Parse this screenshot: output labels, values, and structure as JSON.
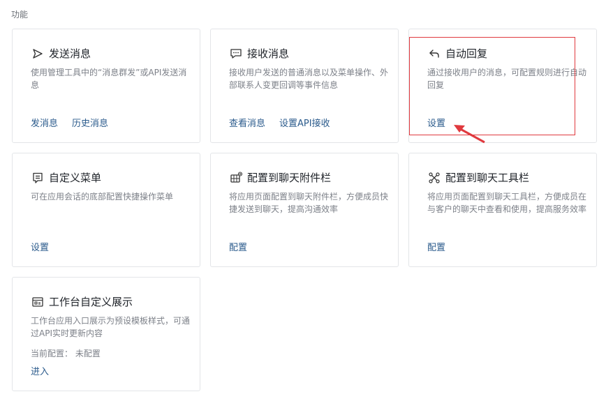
{
  "section_title": "功能",
  "cards": [
    {
      "title": "发送消息",
      "icon": "send-icon",
      "desc": "使用管理工具中的“消息群发”或API发送消息",
      "actions": [
        "发消息",
        "历史消息"
      ]
    },
    {
      "title": "接收消息",
      "icon": "chat-bubble-icon",
      "desc": "接收用户发送的普通消息以及菜单操作、外部联系人变更回调等事件信息",
      "actions": [
        "查看消息",
        "设置API接收"
      ]
    },
    {
      "title": "自动回复",
      "icon": "reply-icon",
      "desc": "通过接收用户的消息，可配置规则进行自动回复",
      "actions": [
        "设置"
      ]
    },
    {
      "title": "自定义菜单",
      "icon": "menu-icon",
      "desc": "可在应用会话的底部配置快捷操作菜单",
      "actions": [
        "设置"
      ]
    },
    {
      "title": "配置到聊天附件栏",
      "icon": "attachment-grid-icon",
      "desc": "将应用页面配置到聊天附件栏，方便成员快捷发送到聊天，提高沟通效率",
      "actions": [
        "配置"
      ]
    },
    {
      "title": "配置到聊天工具栏",
      "icon": "toolbar-icon",
      "desc": "将应用页面配置到聊天工具栏，方便成员在与客户的聊天中查看和使用，提高服务效率",
      "actions": [
        "配置"
      ]
    },
    {
      "title": "工作台自定义展示",
      "icon": "workbench-icon",
      "desc": "工作台应用入口展示为预设模板样式，可通过API实时更新内容",
      "status": "当前配置： 未配置",
      "actions": [
        "进入"
      ]
    }
  ],
  "annotation": {
    "color": "#e0393e"
  }
}
